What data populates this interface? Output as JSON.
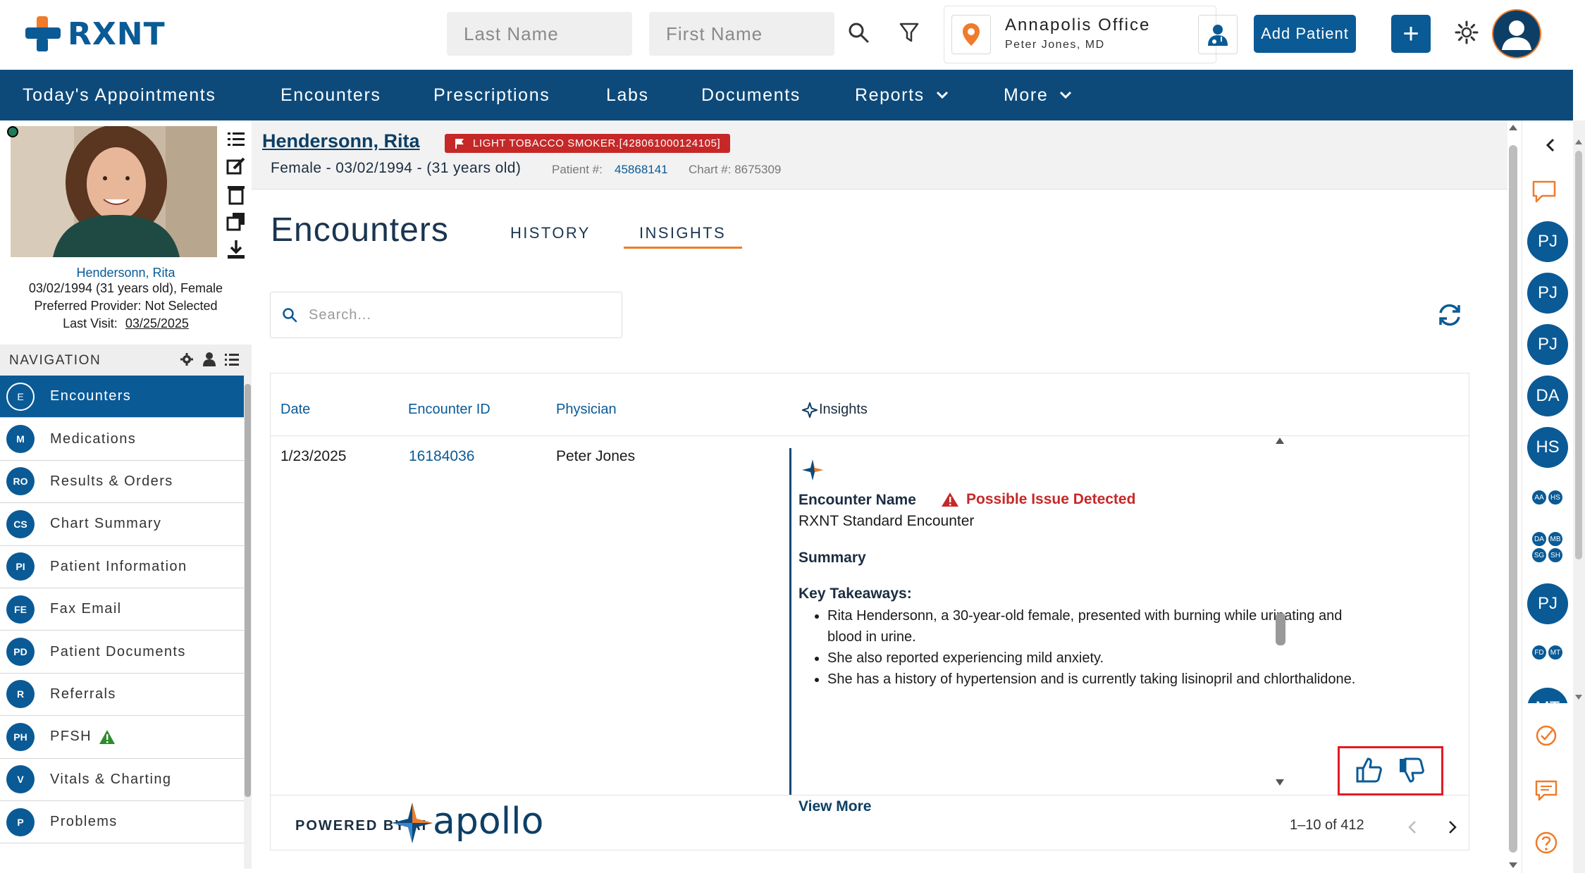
{
  "header": {
    "logo_text": "RXNT",
    "last_name_placeholder": "Last Name",
    "first_name_placeholder": "First Name",
    "office_name": "Annapolis Office",
    "office_doctor": "Peter Jones, MD",
    "add_patient_label": "Add Patient",
    "add_plus_label": "+"
  },
  "topnav": {
    "items": [
      {
        "label": "Today's Appointments"
      },
      {
        "label": "Encounters"
      },
      {
        "label": "Prescriptions"
      },
      {
        "label": "Labs"
      },
      {
        "label": "Documents"
      },
      {
        "label": "Reports"
      },
      {
        "label": "More"
      }
    ]
  },
  "patient_card": {
    "name": "Hendersonn, Rita",
    "dob_line": "03/02/1994 (31 years old), Female",
    "provider_line": "Preferred Provider: Not Selected",
    "last_visit_label": "Last Visit:",
    "last_visit_date": "03/25/2025"
  },
  "left_nav": {
    "header": "NAVIGATION",
    "items": [
      {
        "abbr": "E",
        "label": "Encounters"
      },
      {
        "abbr": "M",
        "label": "Medications"
      },
      {
        "abbr": "RO",
        "label": "Results & Orders"
      },
      {
        "abbr": "CS",
        "label": "Chart Summary"
      },
      {
        "abbr": "PI",
        "label": "Patient Information"
      },
      {
        "abbr": "FE",
        "label": "Fax Email"
      },
      {
        "abbr": "PD",
        "label": "Patient Documents"
      },
      {
        "abbr": "R",
        "label": "Referrals"
      },
      {
        "abbr": "PH",
        "label": "PFSH"
      },
      {
        "abbr": "V",
        "label": "Vitals & Charting"
      },
      {
        "abbr": "P",
        "label": "Problems"
      }
    ]
  },
  "patient_bar": {
    "name": "Hendersonn, Rita",
    "alert": "LIGHT TOBACCO SMOKER.[428061000124105]",
    "demographics": "Female - 03/02/1994 - (31 years old)",
    "patient_num_label": "Patient #:",
    "patient_num": "45868141",
    "chart_num": "Chart #: 8675309"
  },
  "encounters": {
    "title": "Encounters",
    "tabs": [
      {
        "label": "HISTORY"
      },
      {
        "label": "INSIGHTS"
      }
    ],
    "active_tab": "INSIGHTS",
    "search_placeholder": "Search...",
    "columns": [
      "Date",
      "Encounter ID",
      "Physician",
      "Insights"
    ],
    "row": {
      "date": "1/23/2025",
      "encounter_id": "16184036",
      "physician": "Peter Jones"
    },
    "insight": {
      "encounter_name_label": "Encounter Name",
      "issue": "Possible Issue Detected",
      "encounter_type": "RXNT Standard Encounter",
      "summary_label": "Summary",
      "takeaways_label": "Key Takeaways:",
      "takeaways": [
        "Rita Hendersonn, a 30-year-old female, presented with burning while urinating and blood in urine.",
        "She also reported experiencing mild anxiety.",
        "She has a history of hypertension and is currently taking lisinopril and chlorthalidone."
      ],
      "view_more": "View More"
    },
    "footer": {
      "powered_by": "POWERED BY AI",
      "brand": "apollo",
      "pagination": "1–10 of 412"
    }
  },
  "rail": {
    "avatars": [
      "PJ",
      "PJ",
      "PJ",
      "DA",
      "HS"
    ],
    "mini_pair_1": [
      "AA",
      "HS"
    ],
    "mini_quad": [
      "DA",
      "MB",
      "SG",
      "SH"
    ],
    "avatar_after": "PJ",
    "mini_pair_2": [
      "FD",
      "MT"
    ],
    "avatar_cut": "MT"
  },
  "colors": {
    "brand_blue": "#0a5a96",
    "nav_blue": "#0d4a7a",
    "accent_orange": "#f07b2a",
    "alert_red": "#c62828",
    "highlight_red": "#e01b24"
  }
}
